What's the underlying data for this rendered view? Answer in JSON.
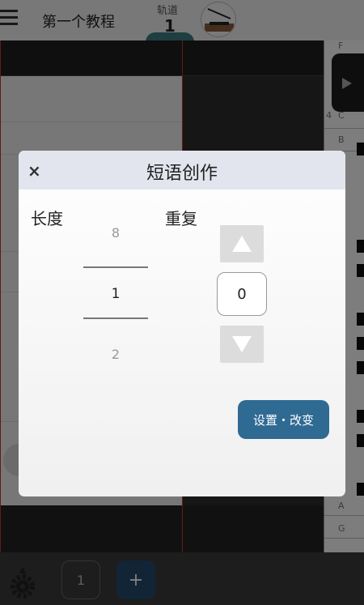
{
  "app": {
    "title": "第一个教程",
    "track_label": "轨道",
    "track_number": "1",
    "page_number": "1",
    "add_label": "+",
    "piano_notes": [
      "F",
      "4",
      "C",
      "B",
      "A",
      "G"
    ]
  },
  "dialog": {
    "title": "短语创作",
    "close_label": "×",
    "length_label": "长度",
    "repeat_label": "重复",
    "length_picker": {
      "prev": "8",
      "current": "1",
      "next": "2"
    },
    "repeat_value": "0",
    "set_button_label": "设置・改变"
  },
  "colors": {
    "accent_button": "#2f6a93",
    "add_button": "#244a6f",
    "track_indicator": "#3d7d80"
  }
}
